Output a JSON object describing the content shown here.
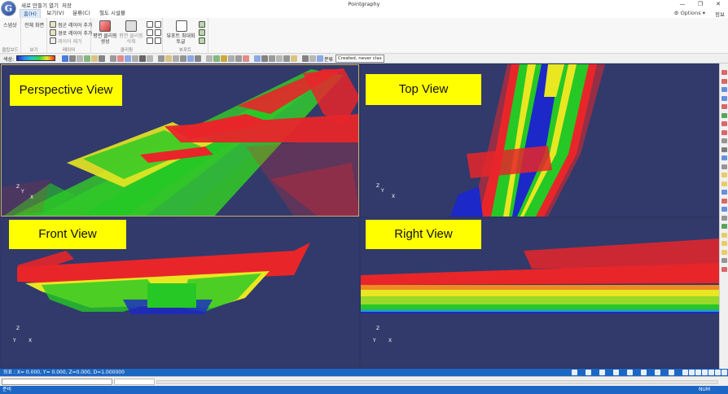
{
  "app": {
    "title": "Pointgraphy",
    "logo_letter": "G",
    "quick_access": [
      "새로 만들기",
      "열기",
      "저장"
    ]
  },
  "window_controls": {
    "minimize": "—",
    "maximize": "❐",
    "close": "✕"
  },
  "tabs": [
    {
      "label": "홈(H)",
      "active": true
    },
    {
      "label": "보기(V)",
      "active": false
    },
    {
      "label": "분류(C)",
      "active": false
    },
    {
      "label": "철도 시설물",
      "active": false
    }
  ],
  "options_label": "Options",
  "help_label": "정보",
  "ribbon": {
    "clipboard": {
      "label": "클립보드",
      "items": [
        "스냅샷"
      ]
    },
    "view": {
      "label": "보기",
      "items": [
        "전체 화면"
      ]
    },
    "layer": {
      "label": "레이어",
      "items": [
        "점군 레이어 추가",
        "경로 레이어 추가",
        "레이어 제거"
      ]
    },
    "clipping": {
      "label": "클리핑",
      "items": [
        "평면 클리핑 생성",
        "평면 클리핑 삭제"
      ]
    },
    "viewport": {
      "label": "뷰포트",
      "items": [
        "뷰포트 최대화 토글"
      ]
    }
  },
  "toolbar": {
    "color_label": "색상:",
    "class_label": "분류",
    "class_value": "Created, never clas"
  },
  "viewports": [
    {
      "label": "Perspective View",
      "axes": {
        "z": "Z",
        "y": "Y",
        "x": "X"
      }
    },
    {
      "label": "Top View",
      "axes": {
        "z": "Z",
        "y": "Y",
        "x": "X"
      }
    },
    {
      "label": "Front View",
      "axes": {
        "z": "Z",
        "y": "Y",
        "x": "X"
      }
    },
    {
      "label": "Right View",
      "axes": {
        "z": "Z",
        "y": "Y",
        "x": "X"
      }
    }
  ],
  "coords": "좌표 : X= 0.000, Y= 0.000, Z=0.000, D=1.000000",
  "status": {
    "ready": "준비",
    "num": "NUM"
  },
  "colors": {
    "viewport_bg": "#313a6b",
    "label_bg": "#ffff00",
    "status_bar": "#1c67c4",
    "cloud_red": "#e8262a",
    "cloud_yellow": "#e9e722",
    "cloud_green": "#26c826",
    "cloud_blue": "#1c28c8"
  }
}
